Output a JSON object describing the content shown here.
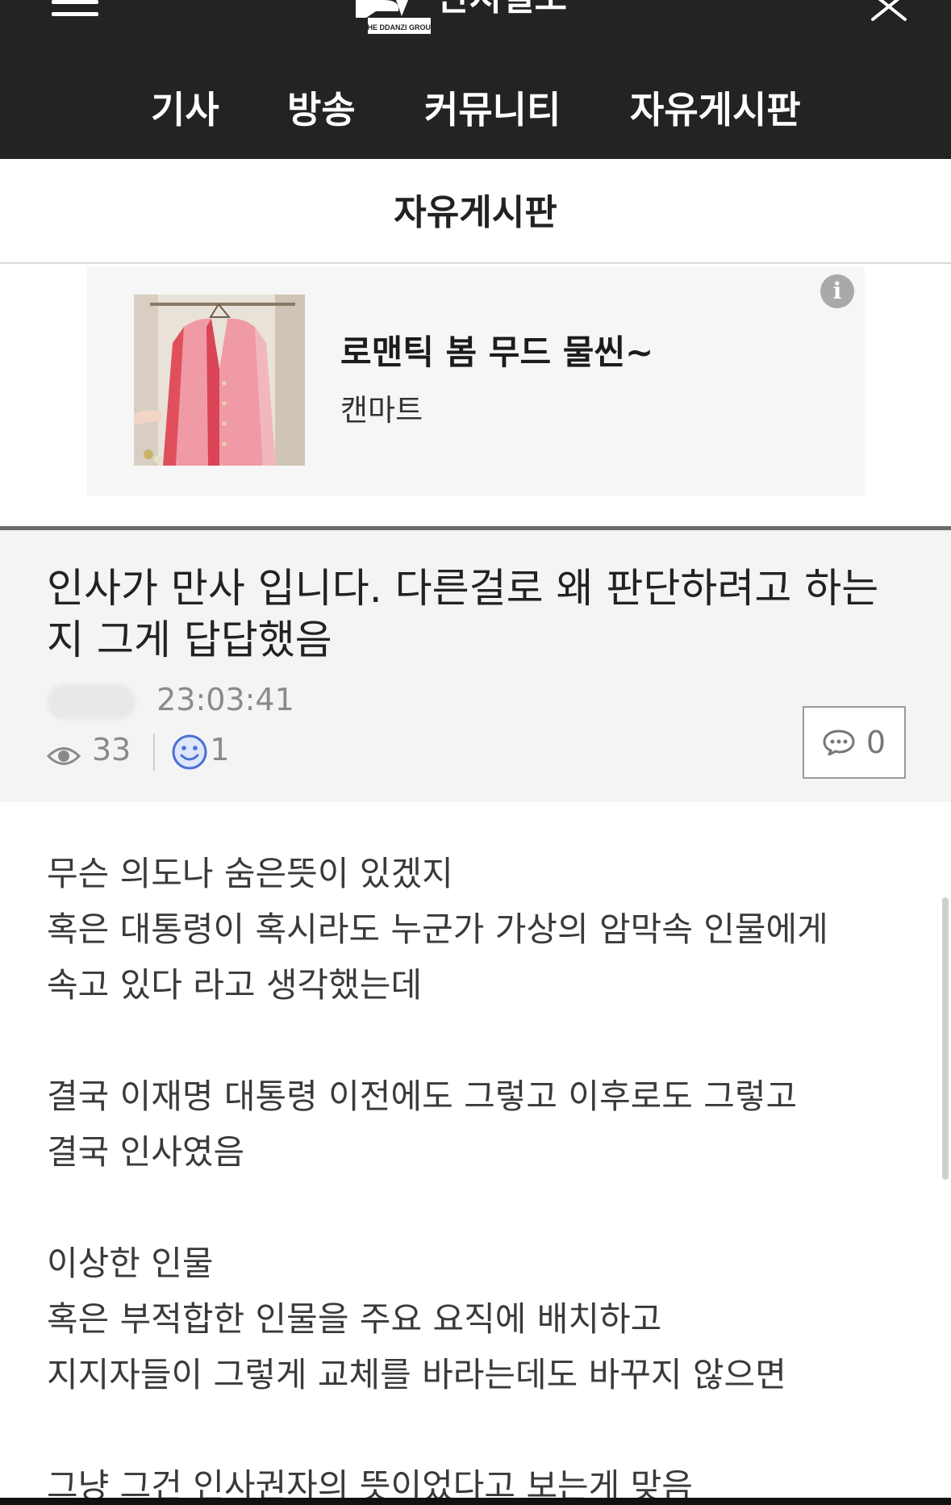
{
  "header": {
    "logo_text": "딴지일보",
    "logo_sub": "THE DDANZI GROUP",
    "nav": [
      "기사",
      "방송",
      "커뮤니티",
      "자유게시판"
    ]
  },
  "board": {
    "title": "자유게시판"
  },
  "ad": {
    "title": "로맨틱 봄 무드 물씬~",
    "brand": "캔마트",
    "info_icon": "i"
  },
  "post": {
    "title": "인사가 만사 입니다. 다른걸로 왜 판단하려고 하는지 그게 답답했음",
    "time": "23:03:41",
    "views": "33",
    "likes": "1",
    "comments": "0",
    "body": [
      "무슨 의도나 숨은뜻이 있겠지",
      "혹은 대통령이 혹시라도 누군가 가상의 암막속 인물에게",
      "속고 있다 라고 생각했는데",
      "",
      "결국 이재명 대통령 이전에도 그렇고 이후로도 그렇고",
      "결국 인사였음",
      "",
      "이상한 인물",
      "혹은 부적합한 인물을 주요 요직에 배치하고",
      "지지자들이 그렇게 교체를 바라는데도 바꾸지 않으면",
      "",
      "그냥 그건 인사권자의 뜻이었다고 보는게 맞음"
    ]
  },
  "colors": {
    "header_bg": "#232323",
    "ad_bg": "#f6f6f6",
    "post_head_bg": "#f4f4f4",
    "like_blue": "#4a6fd6"
  }
}
